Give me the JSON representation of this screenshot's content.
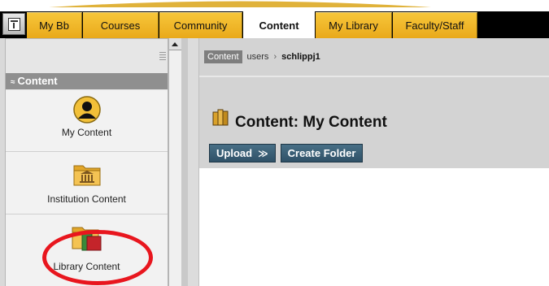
{
  "tabs": [
    {
      "label": "My Bb",
      "active": false
    },
    {
      "label": "Courses",
      "active": false
    },
    {
      "label": "Community",
      "active": false
    },
    {
      "label": "Content",
      "active": true
    },
    {
      "label": "My Library",
      "active": false
    },
    {
      "label": "Faculty/Staff",
      "active": false
    }
  ],
  "sidebar": {
    "header": "Content",
    "items": [
      {
        "label": "My Content",
        "icon": "user-silhouette-icon"
      },
      {
        "label": "Institution Content",
        "icon": "institution-folder-icon"
      },
      {
        "label": "Library Content",
        "icon": "library-folder-icon"
      }
    ]
  },
  "breadcrumb": {
    "tag": "Content",
    "parts": [
      "users",
      "schlippj1"
    ],
    "separator": "›"
  },
  "page": {
    "title": "Content: My Content",
    "title_icon": "book-stack-icon"
  },
  "toolbar": {
    "upload_label": "Upload",
    "upload_chevron": "≫",
    "create_folder_label": "Create Folder"
  },
  "colors": {
    "tab_gold": "#f0b52a",
    "tab_bar": "#000000",
    "button_blue": "#3b5f76",
    "sidebar_header": "#8f8f8f",
    "annotation_red": "#e8161e"
  }
}
